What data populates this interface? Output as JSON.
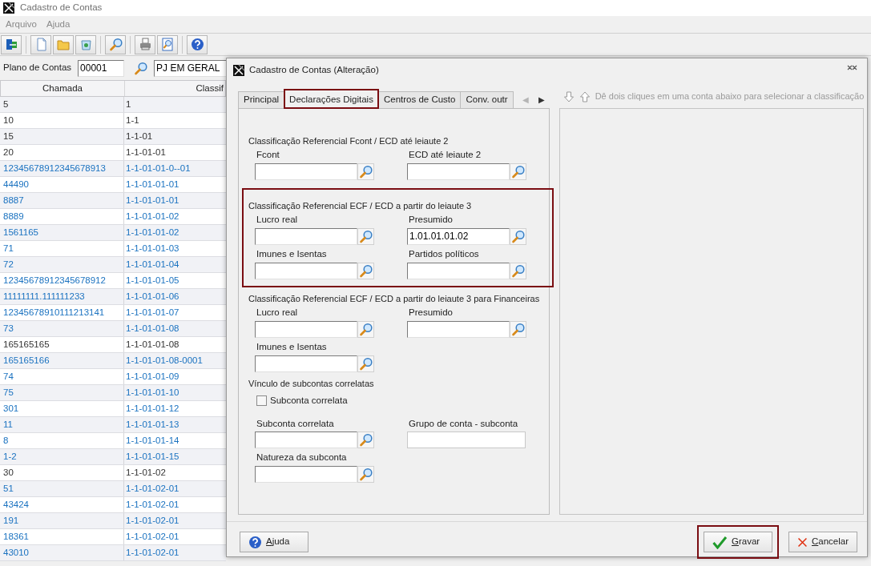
{
  "window": {
    "title": "Cadastro de Contas"
  },
  "menu": [
    {
      "label": "Arquivo"
    },
    {
      "label": "Ajuda"
    }
  ],
  "filter": {
    "label": "Plano de Contas",
    "code": "00001",
    "description": "PJ EM GERAL"
  },
  "table": {
    "columns": [
      "Chamada",
      "Classif"
    ],
    "rows": [
      {
        "cells": [
          "5",
          "1"
        ],
        "linked": false
      },
      {
        "cells": [
          "10",
          "1-1"
        ],
        "linked": false
      },
      {
        "cells": [
          "15",
          "1-1-01"
        ],
        "linked": false
      },
      {
        "cells": [
          "20",
          "1-1-01-01"
        ],
        "linked": false
      },
      {
        "cells": [
          "12345678912345678913",
          "1-1-01-01-0--01"
        ],
        "linked": true
      },
      {
        "cells": [
          "44490",
          "1-1-01-01-01"
        ],
        "linked": true
      },
      {
        "cells": [
          "8887",
          "1-1-01-01-01"
        ],
        "linked": true
      },
      {
        "cells": [
          "8889",
          "1-1-01-01-02"
        ],
        "linked": true
      },
      {
        "cells": [
          "1561165",
          "1-1-01-01-02"
        ],
        "linked": true
      },
      {
        "cells": [
          "71",
          "1-1-01-01-03"
        ],
        "linked": true
      },
      {
        "cells": [
          "72",
          "1-1-01-01-04"
        ],
        "linked": true
      },
      {
        "cells": [
          "12345678912345678912",
          "1-1-01-01-05"
        ],
        "linked": true
      },
      {
        "cells": [
          "11111111.111111233",
          "1-1-01-01-06"
        ],
        "linked": true
      },
      {
        "cells": [
          "12345678910111213141",
          "1-1-01-01-07"
        ],
        "linked": true
      },
      {
        "cells": [
          "73",
          "1-1-01-01-08"
        ],
        "linked": true
      },
      {
        "cells": [
          "165165165",
          "1-1-01-01-08"
        ],
        "linked": false
      },
      {
        "cells": [
          "165165166",
          "1-1-01-01-08-0001"
        ],
        "linked": true
      },
      {
        "cells": [
          "74",
          "1-1-01-01-09"
        ],
        "linked": true
      },
      {
        "cells": [
          "75",
          "1-1-01-01-10"
        ],
        "linked": true
      },
      {
        "cells": [
          "301",
          "1-1-01-01-12"
        ],
        "linked": true
      },
      {
        "cells": [
          "11",
          "1-1-01-01-13"
        ],
        "linked": true
      },
      {
        "cells": [
          "8",
          "1-1-01-01-14"
        ],
        "linked": true
      },
      {
        "cells": [
          "1-2",
          "1-1-01-01-15"
        ],
        "linked": true
      },
      {
        "cells": [
          "30",
          "1-1-01-02"
        ],
        "linked": false
      },
      {
        "cells": [
          "51",
          "1-1-01-02-01"
        ],
        "linked": true
      },
      {
        "cells": [
          "43424",
          "1-1-01-02-01"
        ],
        "linked": true
      },
      {
        "cells": [
          "191",
          "1-1-01-02-01"
        ],
        "linked": true
      },
      {
        "cells": [
          "18361",
          "1-1-01-02-01"
        ],
        "linked": true
      },
      {
        "cells": [
          "43010",
          "1-1-01-02-01"
        ],
        "linked": true
      }
    ]
  },
  "dialog": {
    "title": "Cadastro de Contas (Alteração)",
    "tabs": [
      {
        "label": "Principal",
        "selected": false,
        "highlighted": false
      },
      {
        "label": "Declarações Digitais",
        "selected": true,
        "highlighted": true
      },
      {
        "label": "Centros de Custo",
        "selected": false,
        "highlighted": false
      },
      {
        "label": "Conv. outr",
        "selected": false,
        "highlighted": false
      }
    ],
    "tab_scroll": [
      {
        "label": "◀",
        "disabled": true
      },
      {
        "label": "▶",
        "disabled": false
      }
    ],
    "sections": [
      {
        "title": "Classificação Referencial Fcont / ECD até leiaute 2",
        "highlighted": false,
        "items": [
          {
            "kind": "lookup",
            "label": "Fcont"
          },
          {
            "kind": "lookup",
            "label": "ECD até leiaute 2"
          }
        ]
      },
      {
        "title": "Classificação Referencial ECF / ECD a partir do leiaute 3",
        "highlighted": true,
        "items": [
          {
            "kind": "lookup",
            "label": "Lucro real"
          },
          {
            "kind": "lookup",
            "label": "Presumido",
            "value": "1.01.01.01.02"
          },
          {
            "kind": "lookup",
            "label": "Imunes e Isentas"
          },
          {
            "kind": "lookup",
            "label": "Partidos políticos"
          }
        ]
      },
      {
        "title": "Classificação Referencial ECF / ECD a partir do leiaute 3 para Financeiras",
        "highlighted": false,
        "items": [
          {
            "kind": "lookup",
            "label": "Lucro real"
          },
          {
            "kind": "lookup",
            "label": "Presumido"
          },
          {
            "kind": "lookup",
            "label": "Imunes e Isentas"
          }
        ]
      },
      {
        "title": "Vínculo de subcontas correlatas",
        "highlighted": false,
        "items": [
          {
            "kind": "checkbox",
            "label": "Subconta correlata",
            "checked": false
          },
          {
            "kind": "lookup",
            "label": "Subconta correlata"
          },
          {
            "kind": "text",
            "label": "Grupo de conta - subconta"
          },
          {
            "kind": "lookup",
            "label": "Natureza da subconta"
          }
        ]
      }
    ],
    "hint": "Dê dois cliques em uma conta abaixo para selecionar a classificação",
    "buttons": [
      {
        "label": "Ajuda",
        "kind": "help",
        "highlighted": false
      },
      {
        "label": "Gravar",
        "kind": "save",
        "highlighted": true
      },
      {
        "label": "Cancelar",
        "kind": "cancel",
        "highlighted": false
      }
    ]
  }
}
